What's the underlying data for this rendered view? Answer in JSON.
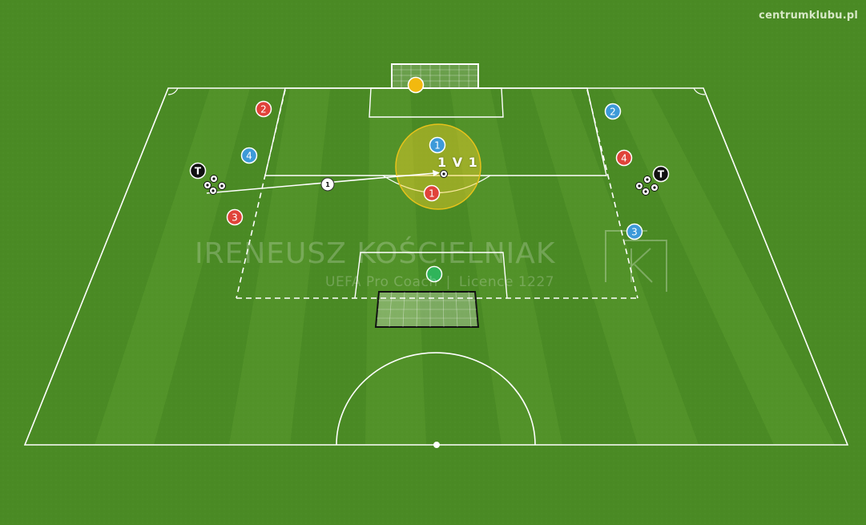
{
  "site": {
    "label": "centrumklubu.pl"
  },
  "watermark": {
    "name": "IRENEUSZ KOŚCIELNIAK",
    "role": "UEFA Pro Coach",
    "separator": "|",
    "licence": "Licence 1227",
    "logo_letter": "K"
  },
  "zone": {
    "label": "1 V 1"
  },
  "colors": {
    "grass": "#4a8a24",
    "grass_light": "#5a9a2e",
    "red_team": "#e0433a",
    "blue_team": "#3d9ad9",
    "goalkeeper": "#f2b90f",
    "neutral": "#2fb45a",
    "coach": "#111111",
    "zone_fill": "#f5d02a"
  },
  "players": {
    "red": [
      {
        "number": "1"
      },
      {
        "number": "2"
      },
      {
        "number": "3"
      },
      {
        "number": "4"
      },
      {
        "number": "3"
      }
    ],
    "blue": [
      {
        "number": "1"
      },
      {
        "number": "4"
      },
      {
        "number": "2"
      },
      {
        "number": "3"
      }
    ],
    "coaches": [
      {
        "label": "T"
      },
      {
        "label": "T"
      }
    ],
    "goalkeeper": {
      "number": ""
    },
    "neutral": {
      "number": ""
    }
  },
  "pass": {
    "label": "1"
  },
  "icons": {
    "ball": "soccer-ball-icon",
    "goal": "goal-icon",
    "logo": "k-logo-icon"
  }
}
